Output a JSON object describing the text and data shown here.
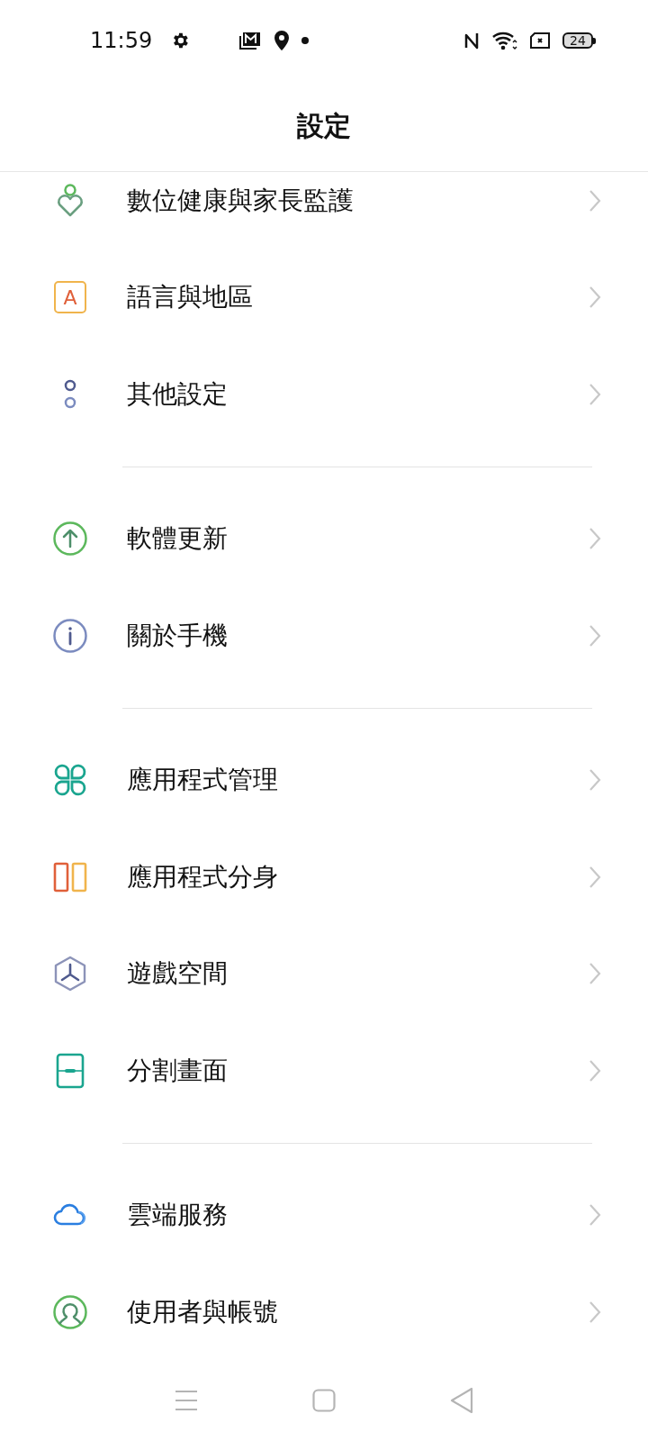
{
  "status_bar": {
    "time": "11:59",
    "battery": "24"
  },
  "header": {
    "title": "設定"
  },
  "groups": [
    {
      "items": [
        {
          "label": "數位健康與家長監護"
        },
        {
          "label": "語言與地區",
          "icon_text": "A"
        },
        {
          "label": "其他設定"
        }
      ]
    },
    {
      "items": [
        {
          "label": "軟體更新"
        },
        {
          "label": "關於手機"
        }
      ]
    },
    {
      "items": [
        {
          "label": "應用程式管理"
        },
        {
          "label": "應用程式分身"
        },
        {
          "label": "遊戲空間"
        },
        {
          "label": "分割畫面"
        }
      ]
    },
    {
      "items": [
        {
          "label": "雲端服務"
        },
        {
          "label": "使用者與帳號"
        }
      ]
    }
  ]
}
